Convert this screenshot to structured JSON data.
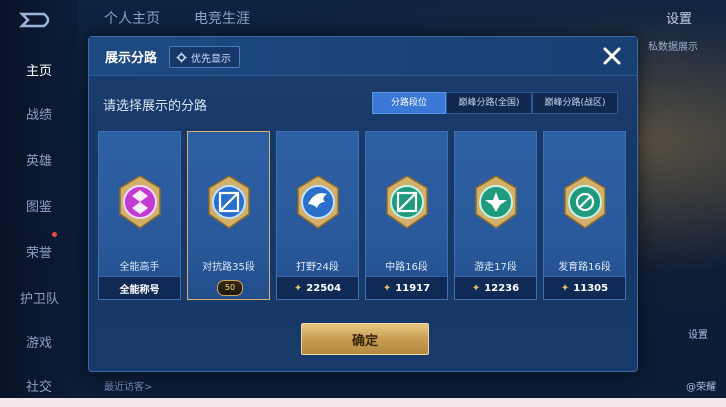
{
  "background": {
    "top_tabs": [
      "个人主页",
      "电竞生涯"
    ],
    "settings_label": "设置",
    "right_note": "私数据展示",
    "sidebar": [
      "主页",
      "战绩",
      "英雄",
      "图鉴",
      "荣誉",
      "护卫队",
      "游戏",
      "社交"
    ],
    "bottom_hint": "最近访客>",
    "right_buttons": [
      "设置",
      "@荣耀"
    ]
  },
  "modal": {
    "title": "展示分路",
    "priority_label": "优先显示",
    "subtitle": "请选择展示的分路",
    "tabs": [
      "分路段位",
      "巅峰分路(全国)",
      "巅峰分路(战区)"
    ],
    "active_tab": "分路段位",
    "cards": [
      {
        "name": "全能高手",
        "footer": "全能称号",
        "icon": "all-round-emblem",
        "selected": false
      },
      {
        "name": "对抗路35段",
        "footer": "",
        "rank_badge": "50",
        "icon": "clash-lane-emblem",
        "selected": true
      },
      {
        "name": "打野24段",
        "footer": "22504",
        "icon": "jungle-emblem",
        "selected": false
      },
      {
        "name": "中路16段",
        "footer": "11917",
        "icon": "mid-lane-emblem",
        "selected": false
      },
      {
        "name": "游走17段",
        "footer": "12236",
        "icon": "roam-emblem",
        "selected": false
      },
      {
        "name": "发育路16段",
        "footer": "11305",
        "icon": "farm-lane-emblem",
        "selected": false
      }
    ],
    "confirm_label": "确定"
  },
  "colors": {
    "accent_blue": "#3a78d6",
    "gold": "#d9b16a",
    "all_round_purple": "#c23bd0"
  }
}
